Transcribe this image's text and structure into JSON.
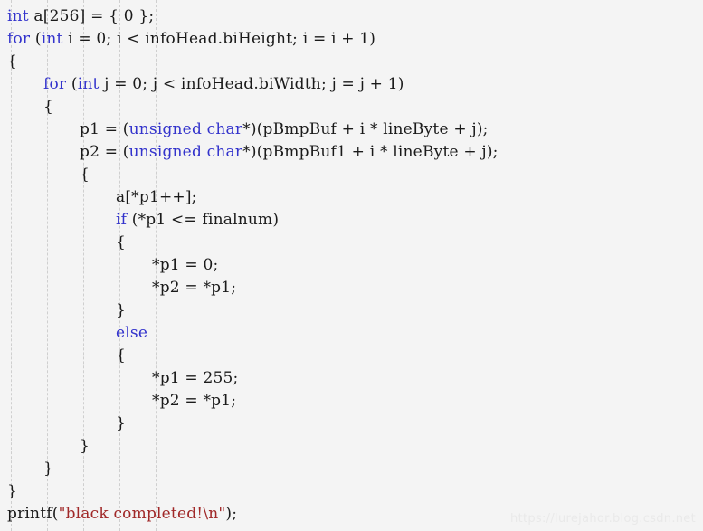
{
  "editor": {
    "background_color": "#f4f4f4",
    "text_color": "#1a1a1a",
    "keyword_color": "#3333cc",
    "string_color": "#a02828",
    "indent_guide_color": "#cfcfcf",
    "language": "c",
    "indent_guide_positions": [
      12,
      52,
      92,
      132,
      172
    ]
  },
  "code": {
    "lines": [
      {
        "indent": 0,
        "tokens": [
          {
            "t": "int",
            "c": "kw"
          },
          {
            "t": " a[256] = { 0 };",
            "c": "plain"
          }
        ]
      },
      {
        "indent": 0,
        "tokens": [
          {
            "t": "for",
            "c": "kw"
          },
          {
            "t": " (",
            "c": "plain"
          },
          {
            "t": "int",
            "c": "kw"
          },
          {
            "t": " i = 0; i < infoHead.biHeight; i = i + 1)",
            "c": "plain"
          }
        ]
      },
      {
        "indent": 0,
        "tokens": [
          {
            "t": "{",
            "c": "plain"
          }
        ]
      },
      {
        "indent": 1,
        "tokens": [
          {
            "t": "for",
            "c": "kw"
          },
          {
            "t": " (",
            "c": "plain"
          },
          {
            "t": "int",
            "c": "kw"
          },
          {
            "t": " j = 0; j < infoHead.biWidth; j = j + 1)",
            "c": "plain"
          }
        ]
      },
      {
        "indent": 1,
        "tokens": [
          {
            "t": "{",
            "c": "plain"
          }
        ]
      },
      {
        "indent": 2,
        "tokens": [
          {
            "t": "p1 = (",
            "c": "plain"
          },
          {
            "t": "unsigned char",
            "c": "kw"
          },
          {
            "t": "*)(pBmpBuf + i * lineByte + j);",
            "c": "plain"
          }
        ]
      },
      {
        "indent": 2,
        "tokens": [
          {
            "t": "p2 = (",
            "c": "plain"
          },
          {
            "t": "unsigned char",
            "c": "kw"
          },
          {
            "t": "*)(pBmpBuf1 + i * lineByte + j);",
            "c": "plain"
          }
        ]
      },
      {
        "indent": 2,
        "tokens": [
          {
            "t": "{",
            "c": "plain"
          }
        ]
      },
      {
        "indent": 3,
        "tokens": [
          {
            "t": "a[*p1++];",
            "c": "plain"
          }
        ]
      },
      {
        "indent": 3,
        "tokens": [
          {
            "t": "if",
            "c": "kw"
          },
          {
            "t": " (*p1 <= finalnum)",
            "c": "plain"
          }
        ]
      },
      {
        "indent": 3,
        "tokens": [
          {
            "t": "{",
            "c": "plain"
          }
        ]
      },
      {
        "indent": 4,
        "tokens": [
          {
            "t": "*p1 = 0;",
            "c": "plain"
          }
        ]
      },
      {
        "indent": 4,
        "tokens": [
          {
            "t": "*p2 = *p1;",
            "c": "plain"
          }
        ]
      },
      {
        "indent": 3,
        "tokens": [
          {
            "t": "}",
            "c": "plain"
          }
        ]
      },
      {
        "indent": 3,
        "tokens": [
          {
            "t": "else",
            "c": "kw"
          }
        ]
      },
      {
        "indent": 3,
        "tokens": [
          {
            "t": "{",
            "c": "plain"
          }
        ]
      },
      {
        "indent": 4,
        "tokens": [
          {
            "t": "*p1 = 255;",
            "c": "plain"
          }
        ]
      },
      {
        "indent": 4,
        "tokens": [
          {
            "t": "*p2 = *p1;",
            "c": "plain"
          }
        ]
      },
      {
        "indent": 3,
        "tokens": [
          {
            "t": "}",
            "c": "plain"
          }
        ]
      },
      {
        "indent": 2,
        "tokens": [
          {
            "t": "}",
            "c": "plain"
          }
        ]
      },
      {
        "indent": 1,
        "tokens": [
          {
            "t": "}",
            "c": "plain"
          }
        ]
      },
      {
        "indent": 0,
        "tokens": [
          {
            "t": "}",
            "c": "plain"
          }
        ]
      },
      {
        "indent": 0,
        "tokens": [
          {
            "t": "printf(",
            "c": "plain"
          },
          {
            "t": "\"black completed!\\n\"",
            "c": "str"
          },
          {
            "t": ");",
            "c": "plain"
          }
        ]
      }
    ]
  },
  "watermark": {
    "text": "https://lurejahor.blog.csdn.net"
  }
}
